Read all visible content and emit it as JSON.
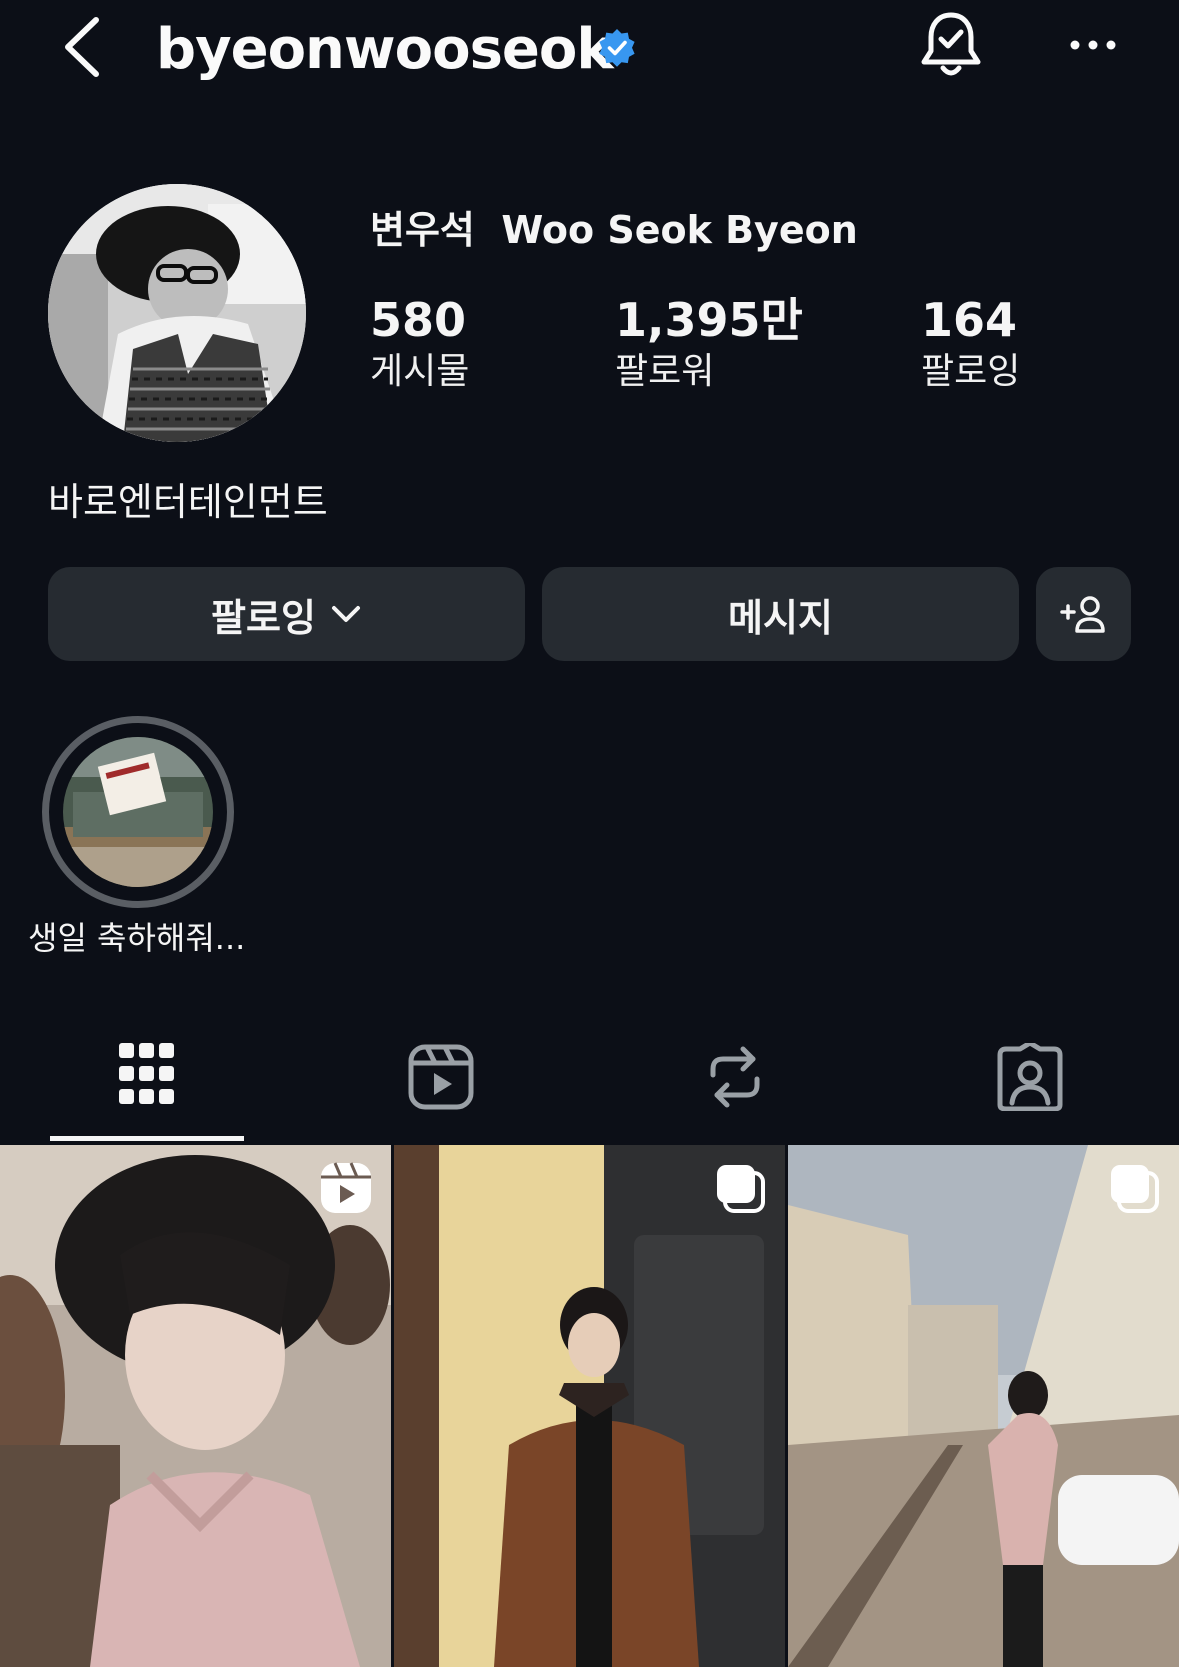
{
  "header": {
    "username": "byeonwooseok",
    "icons": {
      "back": "chevron-left-icon",
      "verified": "verified-badge-icon",
      "notifications": "bell-check-icon",
      "more": "more-options-icon"
    }
  },
  "profile": {
    "display_name": "변우석  Woo Seok Byeon",
    "stats": [
      {
        "value": "580",
        "label": "게시물"
      },
      {
        "value": "1,395만",
        "label": "팔로워"
      },
      {
        "value": "164",
        "label": "팔로잉"
      }
    ],
    "bio": "바로엔터테인먼트"
  },
  "actions": {
    "following_label": "팔로잉",
    "message_label": "메시지",
    "add_person_icon": "add-person-icon"
  },
  "highlights": [
    {
      "label": "생일 축하해줘..."
    }
  ],
  "tabs": [
    {
      "icon": "grid-icon",
      "active": true
    },
    {
      "icon": "reels-icon",
      "active": false
    },
    {
      "icon": "reposts-icon",
      "active": false
    },
    {
      "icon": "tagged-icon",
      "active": false
    }
  ],
  "grid": [
    {
      "badge": "reel-icon"
    },
    {
      "badge": "carousel-icon"
    },
    {
      "badge": "carousel-icon"
    }
  ],
  "colors": {
    "background": "#0c0f17",
    "button": "#262b31",
    "verified": "#3897f0"
  }
}
